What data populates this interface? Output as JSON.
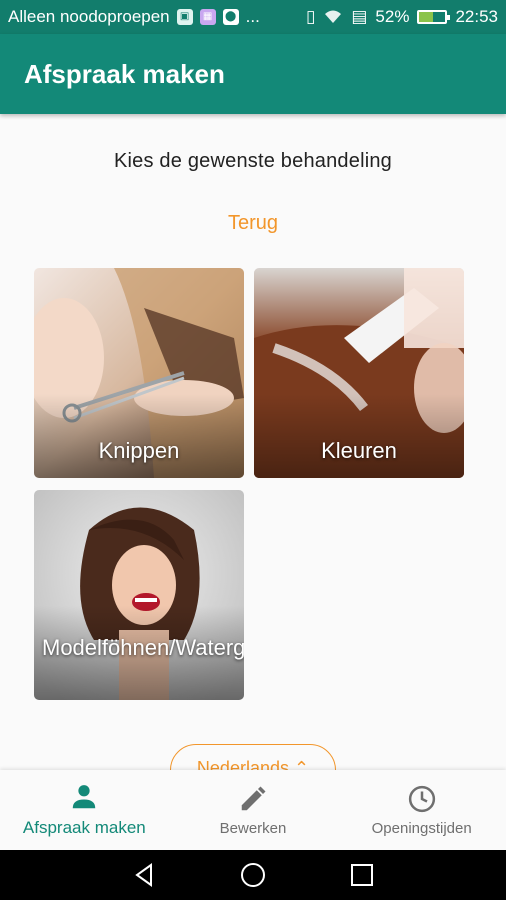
{
  "status_bar": {
    "carrier_text": "Alleen noodoproepen",
    "more_icon": "...",
    "battery_percent": "52%",
    "time": "22:53"
  },
  "app_bar": {
    "title": "Afspraak maken"
  },
  "main": {
    "subtitle": "Kies de gewenste behandeling",
    "back_label": "Terug",
    "treatments": [
      {
        "label": "Knippen",
        "image": "haircut-scissors-photo"
      },
      {
        "label": "Kleuren",
        "image": "hair-coloring-brush-photo"
      },
      {
        "label": "Modelföhnen/Watergolf",
        "image": "woman-bob-hairstyle-photo"
      }
    ],
    "language_button": "Nederlands ⌃"
  },
  "bottom_nav": {
    "items": [
      {
        "label": "Afspraak maken",
        "icon": "person-icon",
        "active": true
      },
      {
        "label": "Bewerken",
        "icon": "pencil-icon",
        "active": false
      },
      {
        "label": "Openingstijden",
        "icon": "clock-icon",
        "active": false
      }
    ]
  },
  "colors": {
    "primary": "#138978",
    "status_bar": "#127d6c",
    "accent": "#f2962b",
    "background": "#fafafa"
  }
}
